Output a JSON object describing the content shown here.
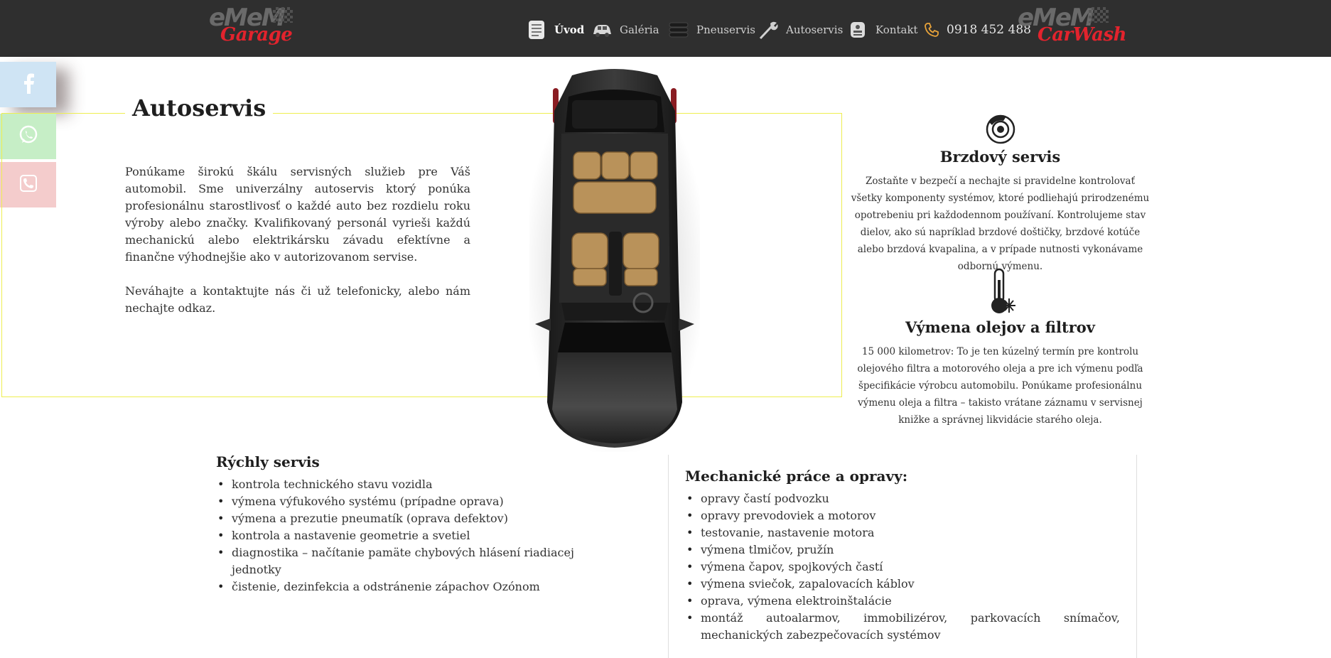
{
  "header": {
    "logo_left": {
      "wordmark": "eMeM",
      "script": "Garage"
    },
    "logo_right": {
      "wordmark": "eMeM",
      "script": "CarWash"
    },
    "nav": [
      {
        "label": "Úvod",
        "icon": "document-icon",
        "active": true
      },
      {
        "label": "Galéria",
        "icon": "car-icon",
        "active": false
      },
      {
        "label": "Pneuservis",
        "icon": "tire-icon",
        "active": false
      },
      {
        "label": "Autoservis",
        "icon": "wrench-icon",
        "active": false
      },
      {
        "label": "Kontakt",
        "icon": "contact-icon",
        "active": false
      }
    ],
    "phone": "0918 452 488"
  },
  "social": [
    {
      "name": "facebook",
      "icon": "facebook-icon",
      "color": "#cfe4f4"
    },
    {
      "name": "whatsapp",
      "icon": "whatsapp-icon",
      "color": "#c6eec6"
    },
    {
      "name": "phone",
      "icon": "phone-icon",
      "color": "#f4cccc"
    }
  ],
  "autoservis": {
    "title": "Autoservis",
    "paragraphs": [
      "Ponúkame širokú škálu servisných služieb pre Váš automobil. Sme univerzálny autoservis ktorý ponúka profesionálnu starostlivosť o každé auto bez rozdielu roku výroby alebo značky. Kvalifikovaný personál vyrieši každú mechanickú alebo elektrikársku závadu efektívne a finančne výhodnejšie ako v autorizovanom servise.",
      "Neváhajte a kontaktujte nás či už telefonicky, alebo nám nechajte odkaz."
    ]
  },
  "services": [
    {
      "title": "Brzdový servis",
      "icon": "brake-disc-icon",
      "text": "Zostaňte v bezpečí a nechajte si pravidelne kontrolovať všetky komponenty systémov, ktoré podliehajú prirodzenému opotrebeniu pri každodennom používaní. Kontrolujeme stav dielov, ako sú napríklad brzdové doštičky, brzdové kotúče alebo brzdová kvapalina, a v prípade nutnosti vykonávame odbornú výmenu."
    },
    {
      "title": "Výmena olejov a filtrov",
      "icon": "thermometer-icon",
      "text": "15 000 kilometrov: To je ten kúzelný termín pre kontrolu olejového filtra a motorového oleja a pre ich výmenu podľa špecifikácie výrobcu automobilu. Ponúkame profesionálnu výmenu oleja a filtra – takisto vrátane záznamu v servisnej knižke a správnej likvidácie starého oleja."
    }
  ],
  "quick_service": {
    "title": "Rýchly servis",
    "items": [
      "kontrola technického stavu vozidla",
      "výmena výfukového systému (prípadne oprava)",
      "výmena a prezutie pneumatík (oprava defektov)",
      "kontrola a nastavenie geometrie a svetiel",
      "diagnostika – načítanie pamäte chybových hlásení riadiacej jednotky",
      "čistenie, dezinfekcia a odstránenie zápachov Ozónom"
    ]
  },
  "mechanical": {
    "title": "Mechanické práce a opravy:",
    "items": [
      "opravy častí podvozku",
      "opravy prevodoviek a motorov",
      "testovanie, nastavenie motora",
      "výmena tlmičov, pružín",
      "výmena čapov, spojkových častí",
      "výmena sviečok, zapalovacích káblov",
      "oprava, výmena elektroinštalácie",
      "montáž autoalarmov, immobilizérov, parkovacích snímačov, mechanických zabezpečovacích systémov"
    ]
  },
  "colors": {
    "header_bg": "#2f2f2f",
    "frame_border": "#eeee50",
    "logo_red": "#e3232d",
    "phone_orange": "#e8a33a"
  }
}
